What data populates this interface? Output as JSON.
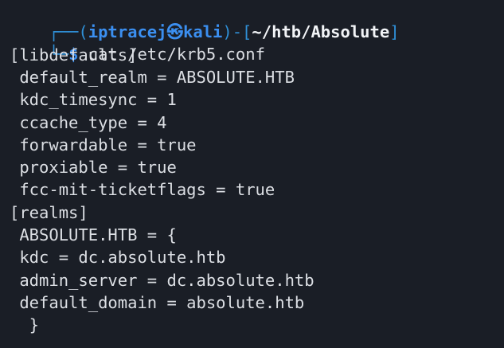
{
  "prompt": {
    "box_top": "┌──(",
    "user": "iptracej",
    "at_symbol": "㉿",
    "host": "kali",
    "mid": ")-[",
    "path": "~/htb/Absolute",
    "close": "]",
    "box_bottom": "└─",
    "dollar": "$",
    "command": " cat /etc/krb5.conf"
  },
  "output_lines": [
    "[libdefaults]",
    " default_realm = ABSOLUTE.HTB",
    " kdc_timesync = 1",
    " ccache_type = 4",
    " forwardable = true",
    " proxiable = true",
    " fcc-mit-ticketflags = true",
    "[realms]",
    " ABSOLUTE.HTB = {",
    " kdc = dc.absolute.htb",
    " admin_server = dc.absolute.htb",
    " default_domain = absolute.htb",
    "  }"
  ],
  "colors": {
    "background": "#1a1e26",
    "prompt_accent": "#3b8ff0",
    "text": "#dcdfe4"
  }
}
